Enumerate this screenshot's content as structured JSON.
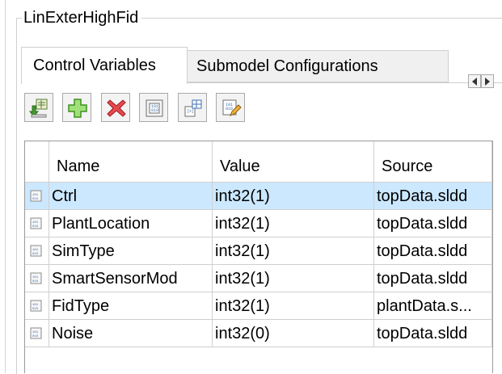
{
  "group": {
    "title": "LinExterHighFid"
  },
  "tabs": [
    {
      "label": "Control Variables",
      "active": true
    },
    {
      "label": "Submodel Configurations",
      "active": false
    }
  ],
  "toolbar": [
    {
      "name": "import-icon"
    },
    {
      "name": "add-icon"
    },
    {
      "name": "delete-icon"
    },
    {
      "name": "variable-usage-icon"
    },
    {
      "name": "create-variable-icon"
    },
    {
      "name": "edit-variable-icon"
    }
  ],
  "table": {
    "columns": [
      "Name",
      "Value",
      "Source"
    ],
    "rows": [
      {
        "name": "Ctrl",
        "value": "int32(1)",
        "source": "topData.sldd",
        "selected": true
      },
      {
        "name": "PlantLocation",
        "value": "int32(1)",
        "source": "topData.sldd",
        "selected": false
      },
      {
        "name": "SimType",
        "value": "int32(1)",
        "source": "topData.sldd",
        "selected": false
      },
      {
        "name": "SmartSensorMod",
        "value": "int32(1)",
        "source": "topData.sldd",
        "selected": false
      },
      {
        "name": "FidType",
        "value": "int32(1)",
        "source": "plantData.s...",
        "selected": false
      },
      {
        "name": "Noise",
        "value": "int32(0)",
        "source": "topData.sldd",
        "selected": false
      }
    ]
  },
  "colors": {
    "selected_row": "#cce8ff",
    "grid": "#cfcfcf"
  }
}
